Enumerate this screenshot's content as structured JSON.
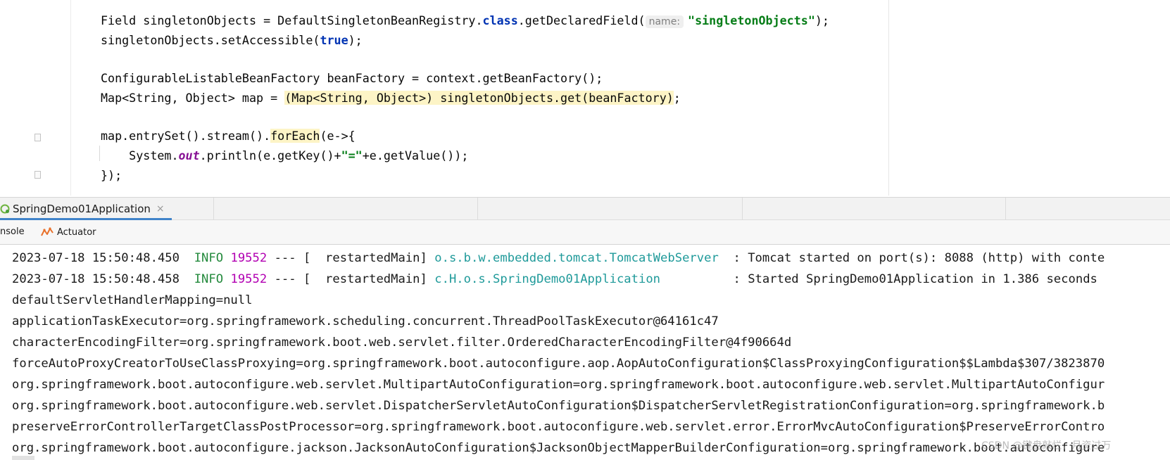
{
  "editor": {
    "lines": {
      "l1": {
        "a": "Field singletonObjects = DefaultSingletonBeanRegistry.",
        "kw": "class",
        "b": ".getDeclaredField(",
        "hint": "name:",
        "str": "\"singletonObjects\"",
        "c": ");"
      },
      "l2": {
        "a": "singletonObjects.setAccessible(",
        "kw": "true",
        "b": ");"
      },
      "l3": {
        "a": "ConfigurableListableBeanFactory beanFactory = context.getBeanFactory();"
      },
      "l4": {
        "a": "Map<String, Object> map = ",
        "hl": "(Map<String, Object>) singletonObjects.get(beanFactory)",
        "b": ";"
      },
      "l5": {
        "a": "map.entrySet().stream().",
        "hl": "forEach",
        "b": "(e->{"
      },
      "l6": {
        "a": "    System.",
        "static": "out",
        "b": ".println(e.getKey()+",
        "str": "\"=\"",
        "c": "+e.getValue());"
      },
      "l7": {
        "a": "});"
      }
    }
  },
  "run_window": {
    "tab_label": "SpringDemo01Application",
    "close_glyph": "×",
    "subtabs": {
      "console": "nsole",
      "actuator": "Actuator"
    }
  },
  "console": {
    "log1": {
      "ts": "2023-07-18 15:50:48.450",
      "level": "INFO",
      "pid": "19552",
      "thread": "--- [  restartedMain]",
      "logger": "o.s.b.w.embedded.tomcat.TomcatWebServer",
      "msg": "  : Tomcat started on port(s): 8088 (http) with conte"
    },
    "log2": {
      "ts": "2023-07-18 15:50:48.458",
      "level": "INFO",
      "pid": "19552",
      "thread": "--- [  restartedMain]",
      "logger": "c.H.o.s.SpringDemo01Application",
      "msg": "          : Started SpringDemo01Application in 1.386 seconds"
    },
    "plain": [
      "defaultServletHandlerMapping=null",
      "applicationTaskExecutor=org.springframework.scheduling.concurrent.ThreadPoolTaskExecutor@64161c47",
      "characterEncodingFilter=org.springframework.boot.web.servlet.filter.OrderedCharacterEncodingFilter@4f90664d",
      "forceAutoProxyCreatorToUseClassProxying=org.springframework.boot.autoconfigure.aop.AopAutoConfiguration$ClassProxyingConfiguration$$Lambda$307/3823870",
      "org.springframework.boot.autoconfigure.web.servlet.MultipartAutoConfiguration=org.springframework.boot.autoconfigure.web.servlet.MultipartAutoConfigur",
      "org.springframework.boot.autoconfigure.web.servlet.DispatcherServletAutoConfiguration$DispatcherServletRegistrationConfiguration=org.springframework.b",
      "preserveErrorControllerTargetClassPostProcessor=org.springframework.boot.autoconfigure.web.servlet.error.ErrorMvcAutoConfiguration$PreserveErrorContro",
      "org.springframework.boot.autoconfigure.jackson.JacksonAutoConfiguration$JacksonObjectMapperBuilderConfiguration=org.springframework.boot.autoconfigure"
    ]
  },
  "watermark": "CSDN @键盘敲烂，月资过万"
}
